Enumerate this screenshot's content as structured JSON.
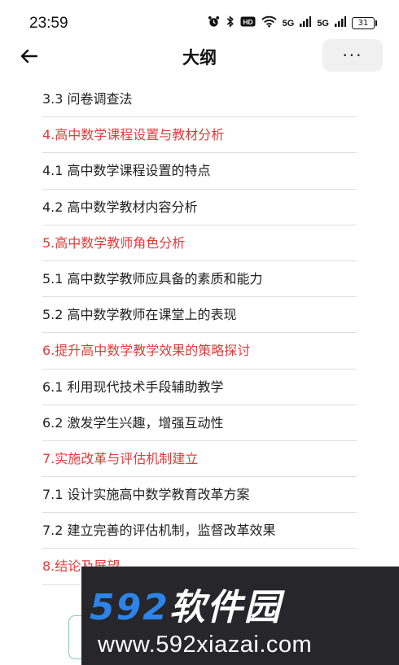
{
  "status_bar": {
    "time": "23:59",
    "signal1": "5G",
    "signal2": "5G",
    "battery": "31",
    "icons": [
      "alarm-icon",
      "bluetooth-icon",
      "hd-icon",
      "wifi-icon",
      "signal-icon",
      "battery-icon"
    ]
  },
  "header": {
    "title": "大纲",
    "more_label": "···"
  },
  "outline": {
    "items": [
      {
        "label": "3.3 问卷调查法",
        "chapter": false
      },
      {
        "label": "4.高中数学课程设置与教材分析",
        "chapter": true
      },
      {
        "label": "4.1 高中数学课程设置的特点",
        "chapter": false
      },
      {
        "label": "4.2 高中数学教材内容分析",
        "chapter": false
      },
      {
        "label": "5.高中数学教师角色分析",
        "chapter": true
      },
      {
        "label": "5.1 高中数学教师应具备的素质和能力",
        "chapter": false
      },
      {
        "label": "5.2 高中数学教师在课堂上的表现",
        "chapter": false
      },
      {
        "label": "6.提升高中数学教学效果的策略探讨",
        "chapter": true
      },
      {
        "label": "6.1 利用现代技术手段辅助教学",
        "chapter": false
      },
      {
        "label": "6.2 激发学生兴趣，增强互动性",
        "chapter": false
      },
      {
        "label": "7.实施改革与评估机制建立",
        "chapter": true
      },
      {
        "label": "7.1 设计实施高中数学教育改革方案",
        "chapter": false
      },
      {
        "label": "7.2 建立完善的评估机制，监督改革效果",
        "chapter": false
      },
      {
        "label": "8.结论及展望",
        "chapter": true
      }
    ]
  },
  "colors": {
    "chapter": "#e03c3c",
    "text": "#222222",
    "divider": "#dedede"
  },
  "watermark": {
    "logo_num": "592",
    "logo_cn": "软件园",
    "url": "www.592xiazai.com"
  }
}
